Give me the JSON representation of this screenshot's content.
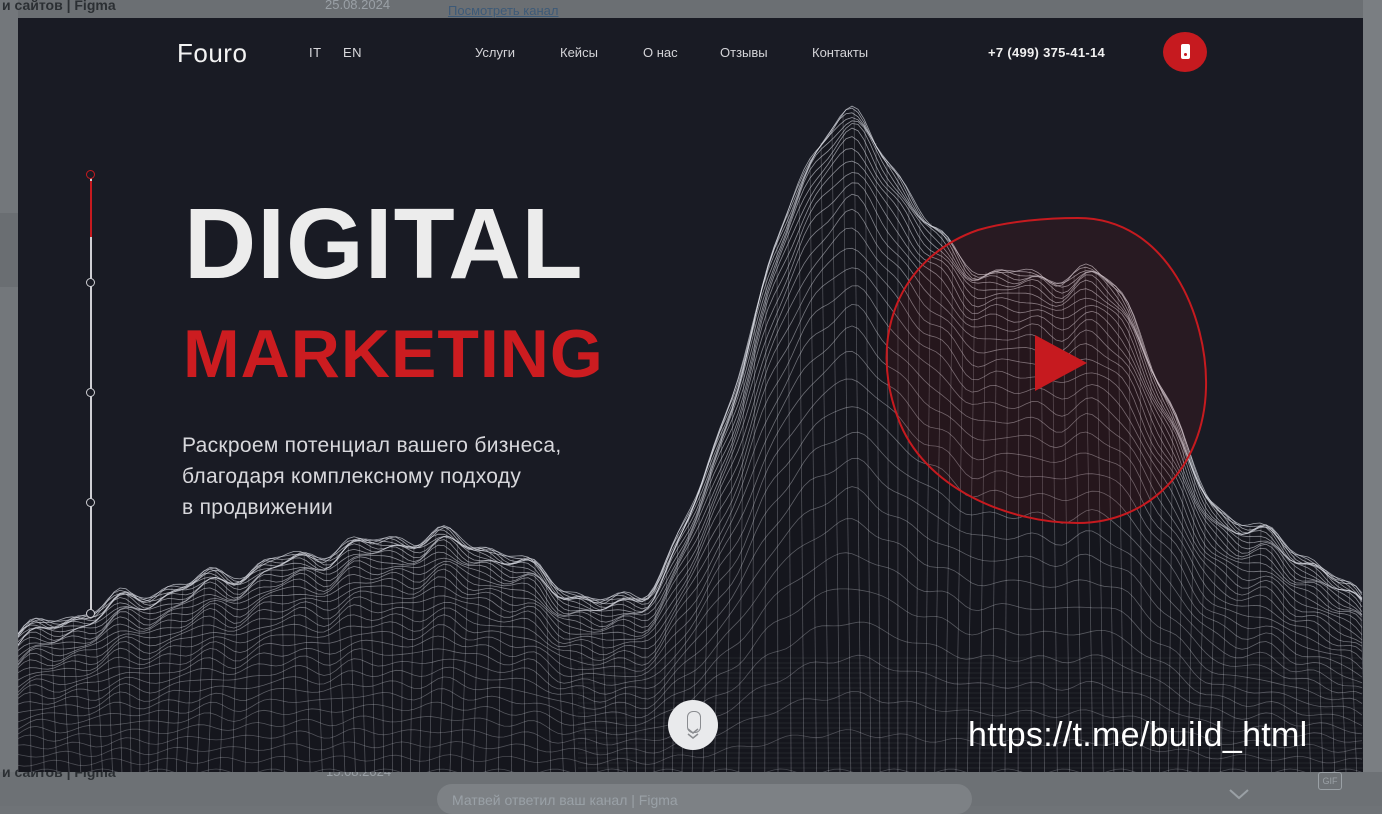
{
  "background_chat": {
    "top_item_title": "и сайтов | Figma",
    "top_item_date": "25.08.2024",
    "top_link": "Посмотреть канал",
    "bottom_item_title": "и сайтов | Figma",
    "bottom_item_date": "15.08.2024",
    "message_input_placeholder": "Матвей ответил ваш канал | Figma",
    "gif_label": "GIF"
  },
  "header": {
    "logo": "Fouro",
    "languages": [
      "IT",
      "EN"
    ],
    "nav": [
      "Услуги",
      "Кейсы",
      "О нас",
      "Отзывы",
      "Контакты"
    ],
    "phone": "+7 (499) 375-41-14",
    "phone_button_icon": "mobile-phone-icon"
  },
  "hero": {
    "headline_line1": "DIGITAL",
    "headline_line2": "MARKETING",
    "tagline": [
      "Раскроем потенциал вашего бизнеса,",
      "благодаря комплексному подходу",
      "в продвижении"
    ],
    "play_icon": "play-icon",
    "scroll_icon": "mouse-scroll-icon"
  },
  "slider": {
    "slides": 5,
    "active_index": 0
  },
  "watermark": "https://t.me/build_html",
  "colors": {
    "accent": "#c61a1f",
    "background": "#191b24",
    "text": "#ececec"
  }
}
